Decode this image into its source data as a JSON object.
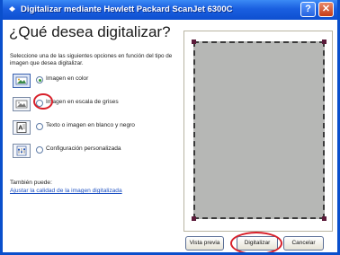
{
  "window": {
    "title": "Digitalizar mediante Hewlett Packard ScanJet 6300C",
    "help_label": "?",
    "close_label": "✕"
  },
  "main": {
    "heading": "¿Qué desea digitalizar?",
    "intro": "Seleccione una de las siguientes opciones en función del tipo de imagen que desea digitalizar.",
    "options": [
      {
        "label": "Imagen en color",
        "selected": true,
        "icon": "color-photo-icon"
      },
      {
        "label": "Imagen en escala de grises",
        "selected": false,
        "icon": "grayscale-photo-icon"
      },
      {
        "label": "Texto o imagen en blanco y negro",
        "selected": false,
        "icon": "text-document-icon"
      },
      {
        "label": "Configuración personalizada",
        "selected": false,
        "icon": "custom-settings-icon"
      }
    ],
    "also_label": "También puede:",
    "quality_link": "Ajustar la calidad de la imagen digitalizada"
  },
  "buttons": {
    "preview": "Vista previa",
    "scan": "Digitalizar",
    "cancel": "Cancelar"
  },
  "colors": {
    "titlebar": "#1a5fe0",
    "highlight": "#d8202a",
    "preview_area": "#b6b7b5"
  }
}
